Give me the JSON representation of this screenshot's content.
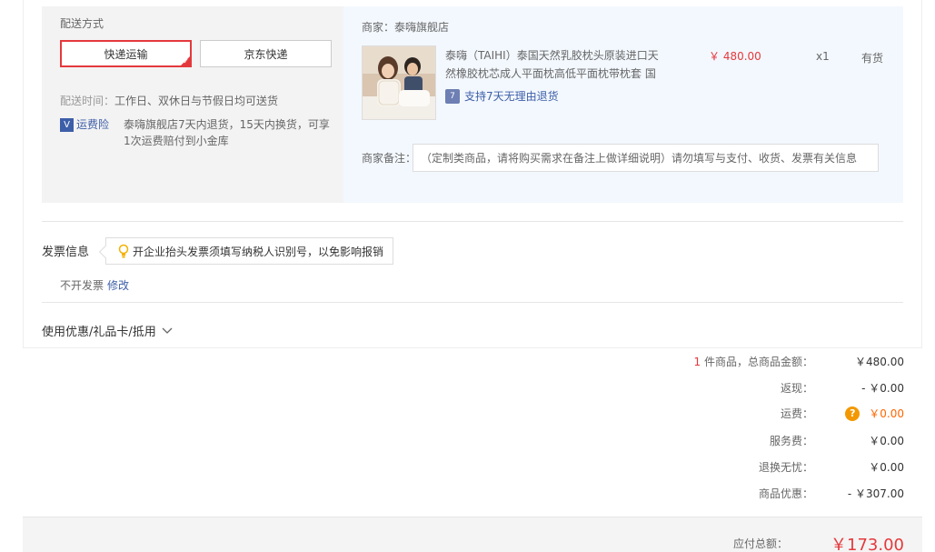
{
  "shipping": {
    "title": "配送方式",
    "options": [
      {
        "label": "快递运输",
        "selected": true
      },
      {
        "label": "京东快递",
        "selected": false
      }
    ],
    "time_label": "配送时间：",
    "time_value": "工作日、双休日与节假日均可送货",
    "insurance_icon": "V",
    "insurance_label": "运费险",
    "insurance_text": "泰嗨旗舰店7天内退货，15天内换货，可享1次运费赔付到小金库"
  },
  "shop": {
    "name": "商家：泰嗨旗舰店",
    "product": {
      "title": "泰嗨（TAIHI）泰国天然乳胶枕头原装进口天然橡胶枕芯成人平面枕高低平面枕带枕套 国",
      "price": "￥ 480.00",
      "qty": "x1",
      "stock": "有货",
      "refund_icon": "7",
      "refund_text": "支持7天无理由退货"
    },
    "remark_label": "商家备注：",
    "remark_placeholder": "（定制类商品，请将购买需求在备注上做详细说明）请勿填写与支付、收货、发票有关信息"
  },
  "invoice": {
    "title": "发票信息",
    "tip": "开企业抬头发票须填写纳税人识别号，以免影响报销",
    "status": "不开发票",
    "edit_label": "修改"
  },
  "coupon": {
    "label": "使用优惠/礼品卡/抵用"
  },
  "summary": {
    "count": "1",
    "count_suffix": " 件商品，总商品金额：",
    "goods_total": "￥480.00",
    "cashback_label": "返现：",
    "cashback": "- ￥0.00",
    "shipping_label": "运费：",
    "shipping_icon": "?",
    "shipping_fee": "￥0.00",
    "service_label": "服务费：",
    "service_fee": "￥0.00",
    "exchange_label": "退换无忧：",
    "exchange_fee": "￥0.00",
    "discount_label": "商品优惠：",
    "discount": "- ￥307.00"
  },
  "total": {
    "label": "应付总额：",
    "value": "￥173.00"
  },
  "colors": {
    "accent_red": "#e4393c",
    "link_blue": "#3d5ea8",
    "warn_orange": "#f39800"
  }
}
